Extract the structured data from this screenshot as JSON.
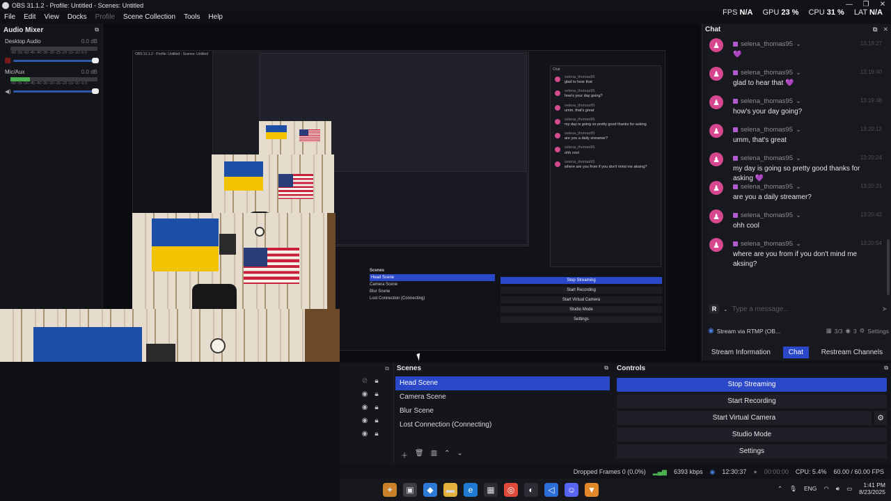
{
  "window": {
    "title": "OBS 31.1.2 - Profile: Untitled - Scenes: Untitled",
    "controls": [
      "—",
      "❐",
      "✕"
    ]
  },
  "menu": [
    "File",
    "Edit",
    "View",
    "Docks",
    "Profile",
    "Scene Collection",
    "Tools",
    "Help"
  ],
  "stats_top": {
    "fps_label": "FPS",
    "fps_value": "N/A",
    "gpu_label": "GPU",
    "gpu_value": "23 %",
    "cpu_label": "CPU",
    "cpu_value": "31 %",
    "lat_label": "LAT",
    "lat_value": "N/A"
  },
  "audio_mixer": {
    "title": "Audio Mixer",
    "channels": [
      {
        "name": "Desktop Audio",
        "db": "0.0 dB",
        "level": 0
      },
      {
        "name": "Mic/Aux",
        "db": "0.0 dB",
        "level": 0.22
      }
    ],
    "scale": "-60 -55 -50 -45 -40 -35 -30 -25 -20 -15 -10 -5 0"
  },
  "chat": {
    "title": "Chat",
    "messages": [
      {
        "user": "selena_thomas95",
        "time": "13:19:27",
        "text": "",
        "emoji": "💜"
      },
      {
        "user": "selena_thomas95",
        "time": "13:19:40",
        "text": "glad to hear that",
        "emoji": "💜"
      },
      {
        "user": "selena_thomas95",
        "time": "13:19:48",
        "text": "how's your day going?",
        "emoji": ""
      },
      {
        "user": "selena_thomas95",
        "time": "13:20:12",
        "text": "umm, that's great",
        "emoji": ""
      },
      {
        "user": "selena_thomas95",
        "time": "13:20:24",
        "text": "my day is going so pretty good thanks for asking",
        "emoji": "💜"
      },
      {
        "user": "selena_thomas95",
        "time": "13:20:31",
        "text": "are you a daily streamer?",
        "emoji": ""
      },
      {
        "user": "selena_thomas95",
        "time": "13:20:42",
        "text": "ohh cool",
        "emoji": ""
      },
      {
        "user": "selena_thomas95",
        "time": "13:20:54",
        "text": "where are you from if you don't mind me aksing?",
        "emoji": ""
      }
    ],
    "input_badge": "R",
    "input_placeholder": "Type a message...",
    "stream_label": "Stream via RTMP (OB...",
    "stream_stats": {
      "a": "3/3",
      "b": "3",
      "settings": "Settings"
    },
    "tabs": [
      "Stream Information",
      "Chat",
      "Restream Channels"
    ],
    "active_tab": "Chat"
  },
  "scenes": {
    "title": "Scenes",
    "items": [
      "Head Scene",
      "Camera Scene",
      "Blur Scene",
      "Lost Connection (Connecting)"
    ],
    "selected": "Head Scene"
  },
  "controls": {
    "title": "Controls",
    "buttons": [
      "Stop Streaming",
      "Start Recording",
      "Start Virtual Camera",
      "Studio Mode",
      "Settings"
    ]
  },
  "status": {
    "dropped": "Dropped Frames 0 (0.0%)",
    "bitrate": "6393 kbps",
    "stream_time": "12:30:37",
    "rec_time": "00:00:00",
    "cpu": "CPU: 5.4%",
    "fps": "60.00 / 60.00 FPS"
  },
  "taskbar": {
    "lang": "ENG",
    "time": "1:41 PM",
    "date": "8/23/2025"
  },
  "nested": {
    "title": "OBS 31.1.2 - Profile: Untitled - Scenes: Untitled",
    "scenes_title": "Scenes",
    "controls_title": "Controls",
    "chat_title": "Chat"
  },
  "colors": {
    "accent": "#2b48c9",
    "avatar": "#d6478f",
    "badge": "#b05cd0"
  }
}
